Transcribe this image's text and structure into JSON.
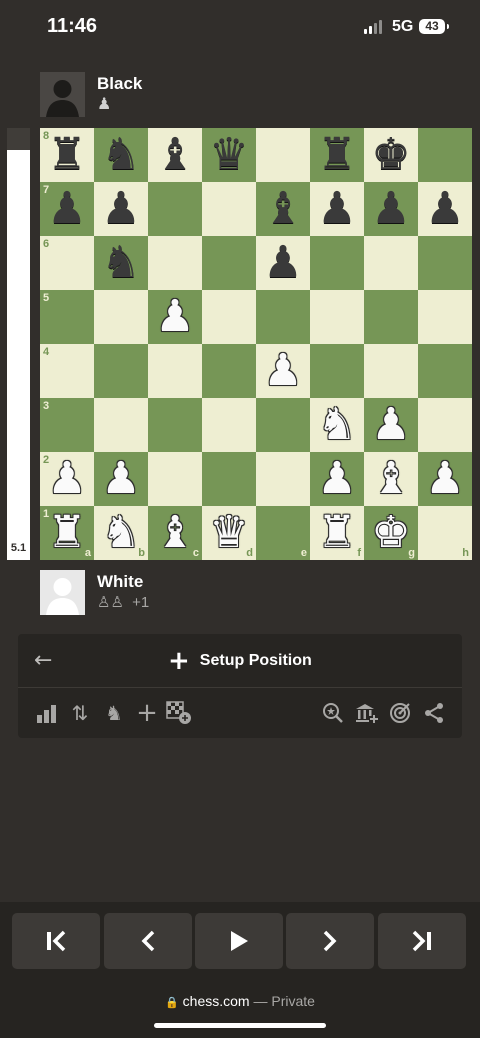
{
  "status_bar": {
    "time": "11:46",
    "network": "5G",
    "battery": "43"
  },
  "top_player": {
    "name": "Black",
    "captured": "♟"
  },
  "bottom_player": {
    "name": "White",
    "captured": "♙♙",
    "advantage": "+1"
  },
  "evaluation": {
    "label": "5.1",
    "white_fraction": 0.95
  },
  "board": {
    "ranks": [
      "8",
      "7",
      "6",
      "5",
      "4",
      "3",
      "2",
      "1"
    ],
    "files": [
      "a",
      "b",
      "c",
      "d",
      "e",
      "f",
      "g",
      "h"
    ],
    "position": [
      [
        "r",
        "n",
        "b",
        "q",
        "",
        "r",
        "k",
        ""
      ],
      [
        "p",
        "p",
        "",
        "",
        "b",
        "p",
        "p",
        "p"
      ],
      [
        "",
        "n",
        "",
        "",
        "p",
        "",
        "",
        ""
      ],
      [
        "",
        "",
        "P",
        "",
        "",
        "",
        "",
        ""
      ],
      [
        "",
        "",
        "",
        "",
        "P",
        "",
        "",
        ""
      ],
      [
        "",
        "",
        "",
        "",
        "",
        "N",
        "P",
        ""
      ],
      [
        "P",
        "P",
        "",
        "",
        "",
        "P",
        "B",
        "P"
      ],
      [
        "R",
        "N",
        "B",
        "Q",
        "",
        "R",
        "K",
        ""
      ]
    ]
  },
  "panel": {
    "back_icon": "arrow-left-icon",
    "setup_label": "Setup Position"
  },
  "toolbar_left": [
    "bar-chart-icon",
    "flip-board-icon",
    "pieces-icon",
    "add-icon",
    "board-add-icon"
  ],
  "toolbar_right": [
    "analysis-icon",
    "library-add-icon",
    "target-icon",
    "share-icon"
  ],
  "navigation": [
    "first-move-icon",
    "prev-move-icon",
    "play-icon",
    "next-move-icon",
    "last-move-icon"
  ],
  "url_bar": {
    "domain": "chess.com",
    "suffix": " — Private"
  },
  "colors": {
    "light_square": "#eeeed2",
    "dark_square": "#769656",
    "background": "#312e2b"
  }
}
